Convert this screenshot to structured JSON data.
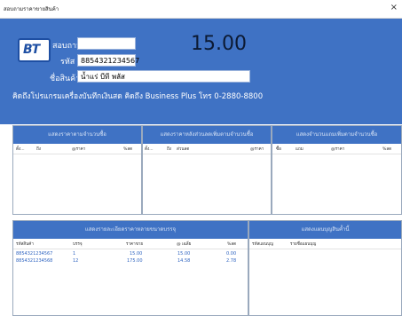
{
  "window": {
    "title": "สอบถามราคาขายสินค้า",
    "close_glyph": "×"
  },
  "header": {
    "logo_text": "BT",
    "scan_label": "สอบถาม",
    "scan_value": "",
    "code_label": "รหัส",
    "code_value": "8854321234567",
    "name_label": "ชื่อสินค้า",
    "name_value": "น้ำแร่ บีที พลัส",
    "price": "15.00",
    "notice": "คิดถึงโปรแกรมเครื่องบันทึกเงินสด คิดถึง Business Plus โทร 0-2880-8800"
  },
  "panels_top": [
    {
      "title": "แสดงราคาตามจำนวนซื้อ",
      "columns": [
        "ตั้ง...",
        "ถึง",
        "@ราคา",
        "%ลด"
      ]
    },
    {
      "title": "แสดงราคาหลังส่วนลดเพิ่มตามจำนวนซื้อ",
      "columns": [
        "ตั้ง...",
        "ถึง",
        "ส่วนลด",
        "@ราคา"
      ]
    },
    {
      "title": "แสดงจำนวนแถมเพิ่มตามจำนวนซื้อ",
      "columns": [
        "ซื้อ",
        "แถม",
        "@ราคา",
        "%ลด"
      ]
    }
  ],
  "packaging_panel": {
    "title": "แสดงรายละเอียดราคาหลายขนาดบรรจุ",
    "columns": [
      "รหัสสินค้า",
      "บรรจุ",
      "ราคาขาย",
      "@ เฉลี่ย",
      "%ลด"
    ],
    "rows": [
      [
        "8854321234567",
        "1",
        "15.00",
        "15.00",
        "0.00"
      ],
      [
        "8854321234568",
        "12",
        "175.00",
        "14.58",
        "2.78"
      ]
    ]
  },
  "set_panel": {
    "title": "แสดงแผนบุญสินค้ำนี้",
    "columns": [
      "รหัสแผนบุญ",
      "รายชื่อแผนบุญ"
    ]
  },
  "colors": {
    "accent": "#3f72c4",
    "row_text": "#2f64c0"
  }
}
